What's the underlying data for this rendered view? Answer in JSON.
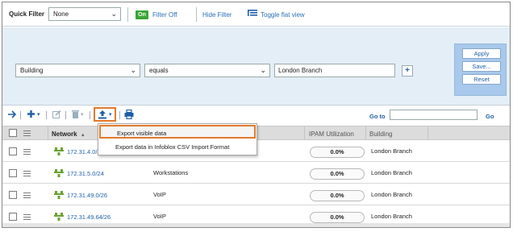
{
  "colors": {
    "accent": "#1f5fa8",
    "on_badge": "#3aa535",
    "highlight_outline": "#e37a2c",
    "filter_panel_bg": "#e4eef6"
  },
  "topbar": {
    "quick_filter_label": "Quick Filter",
    "quick_filter_value": "None",
    "on_badge": "On",
    "filter_off_link": "Filter Off",
    "hide_filter_link": "Hide Filter",
    "toggle_flat_view_link": "Toggle flat view"
  },
  "filter": {
    "field": "Building",
    "operator": "equals",
    "value": "London Branch",
    "add_label": "+",
    "apply_label": "Apply",
    "save_label": "Save...",
    "reset_label": "Reset"
  },
  "toolbar": {
    "goto_label": "Go to",
    "goto_value": "",
    "go_label": "Go",
    "icons": [
      "arrow-right-icon",
      "add-icon",
      "edit-icon",
      "delete-icon",
      "export-icon",
      "print-icon"
    ]
  },
  "export_menu": {
    "items": [
      "Export visible data",
      "Export data in Infoblox CSV Import Format"
    ]
  },
  "grid": {
    "columns": [
      "Network",
      "IPAM Utilization",
      "Building"
    ],
    "sort_indicator": "▲",
    "rows": [
      {
        "network": "172.31.4.0/2",
        "comment": "",
        "utilization": "0.0%",
        "building": "London Branch"
      },
      {
        "network": "172.31.5.0/24",
        "comment": "Workstations",
        "utilization": "0.0%",
        "building": "London Branch"
      },
      {
        "network": "172.31.49.0/26",
        "comment": "VoIP",
        "utilization": "0.0%",
        "building": "London Branch"
      },
      {
        "network": "172.31.49.64/26",
        "comment": "VoIP",
        "utilization": "0.0%",
        "building": "London Branch"
      }
    ]
  }
}
